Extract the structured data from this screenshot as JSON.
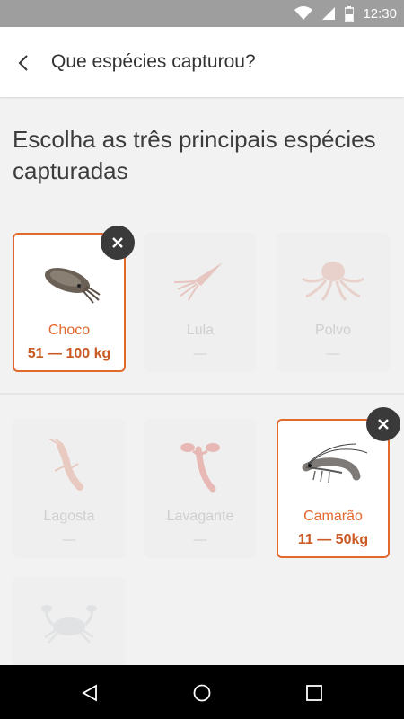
{
  "status_bar": {
    "time": "12:30",
    "icons": [
      "wifi-icon",
      "signal-icon",
      "battery-icon"
    ]
  },
  "app_bar": {
    "title": "Que espécies capturou?",
    "back_icon": "back-arrow-icon"
  },
  "heading": "Escolha as três principais espécies capturadas",
  "colors": {
    "accent": "#e2692e",
    "remove_button": "#3a3a3a"
  },
  "species": [
    {
      "name": "Choco",
      "qty": "51 — 100 kg",
      "selected": true,
      "icon": "cuttlefish-icon"
    },
    {
      "name": "Lula",
      "qty": "—",
      "selected": false,
      "icon": "squid-icon"
    },
    {
      "name": "Polvo",
      "qty": "—",
      "selected": false,
      "icon": "octopus-icon"
    },
    {
      "name": "Lagosta",
      "qty": "—",
      "selected": false,
      "icon": "spiny-lobster-icon"
    },
    {
      "name": "Lavagante",
      "qty": "—",
      "selected": false,
      "icon": "lobster-icon"
    },
    {
      "name": "Camarão",
      "qty": "11 — 50kg",
      "selected": true,
      "icon": "shrimp-icon"
    },
    {
      "name": "",
      "qty": "",
      "selected": false,
      "icon": "crab-icon"
    }
  ],
  "nav_bar": {
    "icons": [
      "nav-back-icon",
      "nav-home-icon",
      "nav-recents-icon"
    ]
  }
}
